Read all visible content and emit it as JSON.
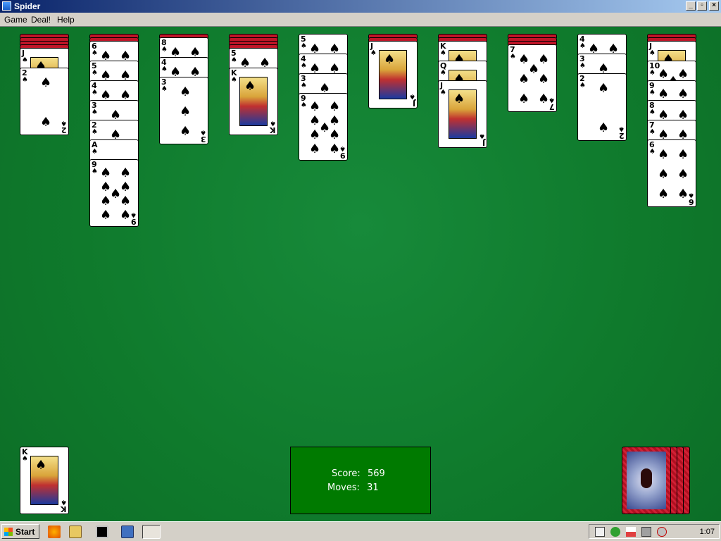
{
  "window": {
    "title": "Spider"
  },
  "menu": {
    "game": "Game",
    "deal": "Deal!",
    "help": "Help"
  },
  "score": {
    "score_label": "Score:",
    "score_value": "569",
    "moves_label": "Moves:",
    "moves_value": "31"
  },
  "taskbar": {
    "start_label": "Start",
    "clock": "1:07"
  },
  "colors": {
    "felt": "#0f7a2c",
    "card_back": "#c01528",
    "score_box": "#007a00",
    "title_bar": "#0a246a"
  },
  "suit_symbol": "♠",
  "tableau": [
    [
      "J",
      "2"
    ],
    [
      "6",
      "5",
      "4",
      "3",
      "2",
      "A",
      "9"
    ],
    [
      "8",
      "4",
      "3"
    ],
    [
      "5",
      "K"
    ],
    [
      "5",
      "4",
      "3",
      "9"
    ],
    [
      "J"
    ],
    [
      "K",
      "Q",
      "J"
    ],
    [
      "7"
    ],
    [
      "4",
      "3",
      "2"
    ],
    [
      "J",
      "10",
      "9",
      "8",
      "7",
      "6"
    ]
  ],
  "foundation": [
    "K"
  ],
  "stock_piles": 4
}
